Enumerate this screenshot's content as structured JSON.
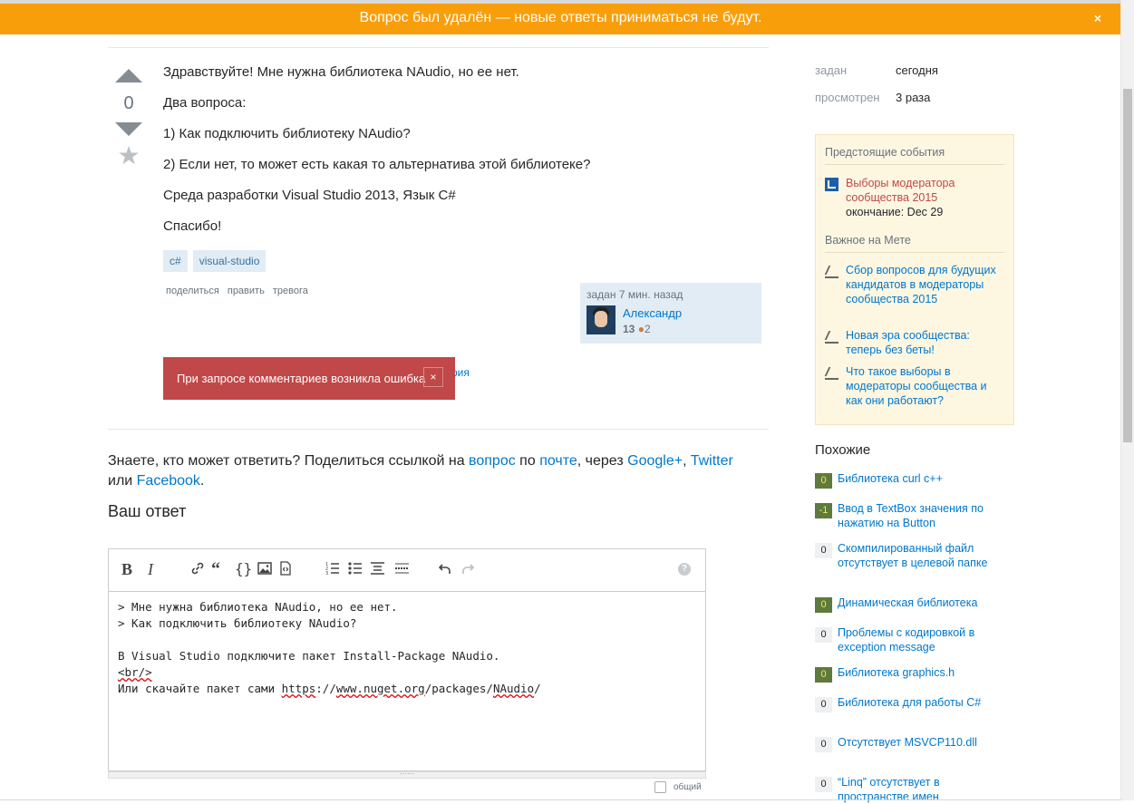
{
  "banner": {
    "text": "Вопрос был удалён — новые ответы приниматься не будут.",
    "close": "×"
  },
  "vote": {
    "count": "0"
  },
  "question": {
    "paragraphs": [
      "Здравствуйте! Мне нужна библиотека NAudio, но ее нет.",
      "Два вопроса:",
      "1) Как подключить библиотеку NAudio?",
      "2) Если нет, то может есть какая то альтернатива этой библиотеке?",
      "Среда разработки Visual Studio 2013, Язык C#",
      "Спасибо!"
    ],
    "tags": [
      "c#",
      "visual-studio"
    ],
    "menu": [
      "поделиться",
      "править",
      "тревога"
    ],
    "owner": {
      "asked": "задан 7 мин. назад",
      "name": "Александр",
      "rep": "13",
      "badge_dot": "●",
      "badge_count": "2"
    },
    "add_comment_fragment": "рия"
  },
  "error": {
    "message": "При запросе комментариев возникла ошибка",
    "close": "×"
  },
  "share": {
    "prefix": "Знаете, кто может ответить? Поделиться ссылкой на ",
    "link_question": "вопрос",
    "by": " по ",
    "link_mail": "почте",
    "via": ", через ",
    "link_google": "Google+",
    "comma": ", ",
    "link_twitter": "Twitter",
    "or": "или ",
    "link_facebook": "Facebook",
    "dot": "."
  },
  "your_answer": "Ваш ответ",
  "editor": {
    "lines": [
      "> Мне нужна библиотека NAudio, но ее нет.",
      "> Как подключить библиотеку NAudio?",
      "",
      "В Visual Studio подключите пакет Install-Package NAudio."
    ],
    "br_line": "<br/>",
    "last_prefix": "Или скачайте пакет сами ",
    "url_https": "https",
    "url_sep1": "://",
    "url_host": "www.nuget.org",
    "url_mid": "/packages/",
    "url_naudio": "NAudio",
    "url_end": "/",
    "community_label": "общий",
    "help_icon": "?"
  },
  "stats": {
    "asked_label": "задан",
    "asked_value": "сегодня",
    "viewed_label": "просмотрен",
    "viewed_value": "3 раза"
  },
  "sidebar": {
    "events_header": "Предстоящие события",
    "event": {
      "title": "Выборы модератора сообщества 2015",
      "ends": "окончание: Dec 29"
    },
    "meta_header": "Важное на Мете",
    "meta_items": [
      "Сбор вопросов для будущих кандидатов в модераторы сообщества 2015",
      "Новая эра сообщества: теперь без беты!",
      "Что такое выборы в модераторы сообщества и как они работают?"
    ]
  },
  "related": {
    "title": "Похожие",
    "items": [
      {
        "score": "0",
        "accepted": true,
        "title": "Библиотека curl c++"
      },
      {
        "score": "-1",
        "accepted": true,
        "title": "Ввод в TextBox значения по нажатию на Button"
      },
      {
        "score": "0",
        "accepted": false,
        "title": "Скомпилированный файл отсутствует в целевой папке"
      },
      {
        "score": "0",
        "accepted": true,
        "title": "Динамическая библиотека"
      },
      {
        "score": "0",
        "accepted": false,
        "title": "Проблемы с кодировкой в exception message"
      },
      {
        "score": "0",
        "accepted": true,
        "title": "Библиотека graphics.h"
      },
      {
        "score": "0",
        "accepted": false,
        "title": "Библиотека для работы C#"
      },
      {
        "score": "0",
        "accepted": false,
        "title": "Отсутствует MSVCP110.dll"
      },
      {
        "score": "0",
        "accepted": false,
        "title": "“Linq” отсутствует в пространстве имен"
      }
    ]
  }
}
